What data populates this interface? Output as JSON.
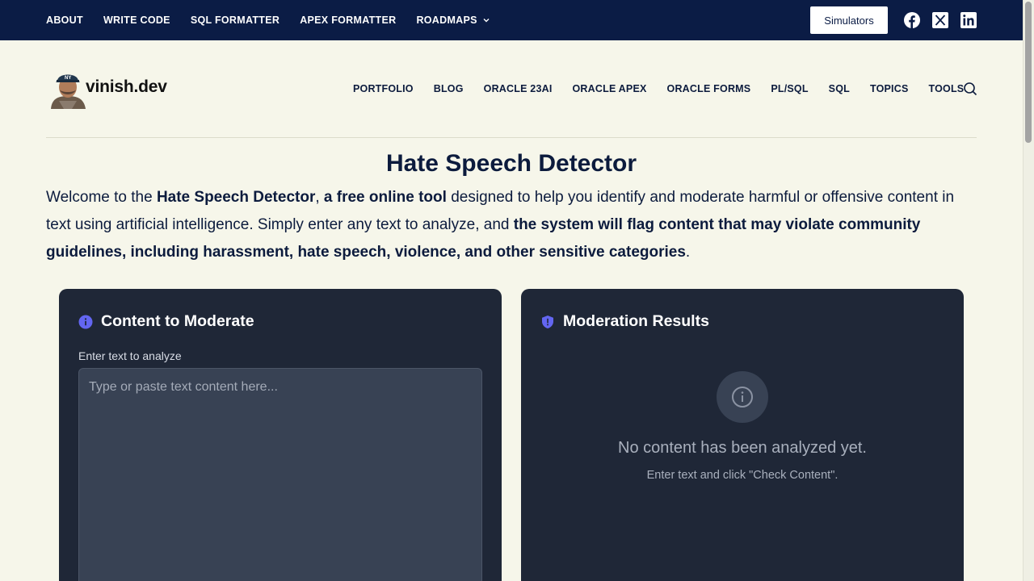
{
  "topbar": {
    "links": [
      "ABOUT",
      "WRITE CODE",
      "SQL FORMATTER",
      "APEX FORMATTER",
      "ROADMAPS"
    ],
    "simulators_label": "Simulators",
    "bg_color": "#0b1c45"
  },
  "header": {
    "logo_text": "vinish.dev",
    "nav": [
      "PORTFOLIO",
      "BLOG",
      "ORACLE 23AI",
      "ORACLE APEX",
      "ORACLE FORMS",
      "PL/SQL",
      "SQL",
      "TOPICS",
      "TOOLS"
    ]
  },
  "main": {
    "title": "Hate Speech Detector",
    "intro": {
      "p1": "Welcome to the ",
      "b1": "Hate Speech Detector",
      "p2": ", ",
      "b2": "a free online tool",
      "p3": " designed to help you identify and moderate harmful or offensive content in text using artificial intelligence. Simply enter any text to analyze, and ",
      "b3": "the system will flag content that may violate community guidelines, including harassment, hate speech, violence, and other sensitive categories",
      "p4": "."
    }
  },
  "content_panel": {
    "title": "Content to Moderate",
    "field_label": "Enter text to analyze",
    "placeholder": "Type or paste text content here...",
    "value": ""
  },
  "results_panel": {
    "title": "Moderation Results",
    "empty_title": "No content has been analyzed yet.",
    "empty_sub": "Enter text and click \"Check Content\"."
  },
  "colors": {
    "page_bg": "#f6f6ea",
    "navy": "#0b1c45",
    "panel_bg": "#1f2737",
    "accent_icon": "#6366f1"
  }
}
